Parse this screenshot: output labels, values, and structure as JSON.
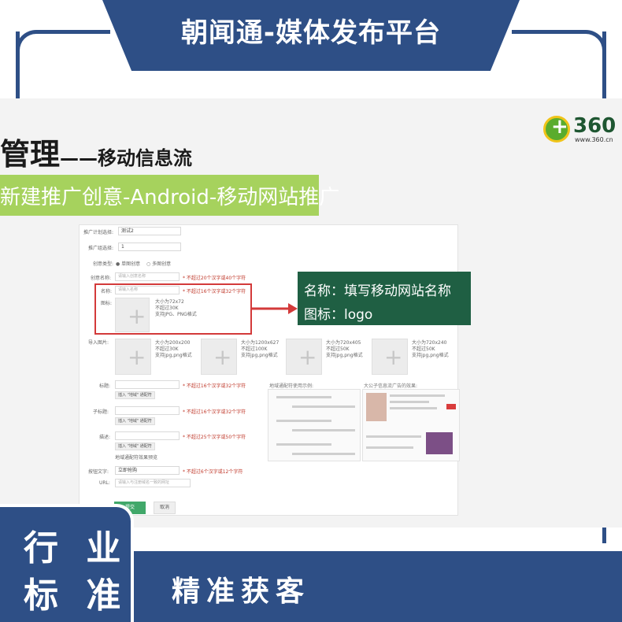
{
  "header": {
    "title": "朝闻通-媒体发布平台"
  },
  "slide": {
    "heading_main": "管理",
    "heading_sub": "——移动信息流",
    "section_banner": "新建推广创意-Android-移动网站推广",
    "logo": {
      "text": "360",
      "sub": "www.360.cn"
    }
  },
  "form": {
    "plan_label": "推广计划选择:",
    "plan_value": "测试2",
    "group_label": "推广组选择:",
    "group_value": "1",
    "type_label": "创意类型:",
    "type_option1": "● 单图创意",
    "type_option2": "○ 多图创意",
    "idea_name_label": "创意名称:",
    "idea_name_placeholder": "请输入创意名称",
    "idea_name_hint": "* 不超过20个汉字或40个字符",
    "name_label": "名称:",
    "name_placeholder": "请输入名称",
    "name_hint": "* 不超过16个汉字或32个字符",
    "icon_label": "图标:",
    "icon_req_1": "大小为72x72",
    "icon_req_2": "不超过30K",
    "icon_req_3": "支持JPG、PNG格式",
    "import_label": "导入图片:",
    "img_reqs": [
      {
        "size": "大小为200x200",
        "limit": "不超过30K",
        "fmt": "支持jpg,png格式"
      },
      {
        "size": "大小为1200x627",
        "limit": "不超过100K",
        "fmt": "支持jpg,png格式"
      },
      {
        "size": "大小为720x405",
        "limit": "不超过50K",
        "fmt": "支持jpg,png格式"
      },
      {
        "size": "大小为720x240",
        "limit": "不超过50K",
        "fmt": "支持jpg,png格式"
      }
    ],
    "title_label": "标题:",
    "title_hint": "* 不超过16个汉字或32个字符",
    "subtitle_label": "子标题:",
    "subtitle_hint": "* 不超过16个汉字或32个字符",
    "desc_label": "描述:",
    "desc_hint": "* 不超过25个汉字或50个字符",
    "insert_btn": "插入 \"地域\" 通配符",
    "region_link": "地域通配符效果预览",
    "button_text_label": "按钮文字:",
    "button_text_value": "立即抢购",
    "button_text_hint": "* 不超过6个汉字或12个字符",
    "url_label": "URL:",
    "url_placeholder": "请输入与注册域名一致的网址",
    "preview_title_1": "地域通配符使用示例:",
    "preview_title_2": "大公子信息流广告的效果:",
    "submit_btn": "提交",
    "cancel_btn": "取消"
  },
  "callout": {
    "line1": "名称：填写移动网站名称",
    "line2": "图标：logo"
  },
  "footer": {
    "badge_line1": "行 业",
    "badge_line2": "标 准",
    "slogan": "精准获客"
  },
  "colors": {
    "primary": "#2e4f86",
    "green_band": "#a6d25d",
    "callout": "#1f5f43",
    "highlight": "#d33a3a"
  }
}
